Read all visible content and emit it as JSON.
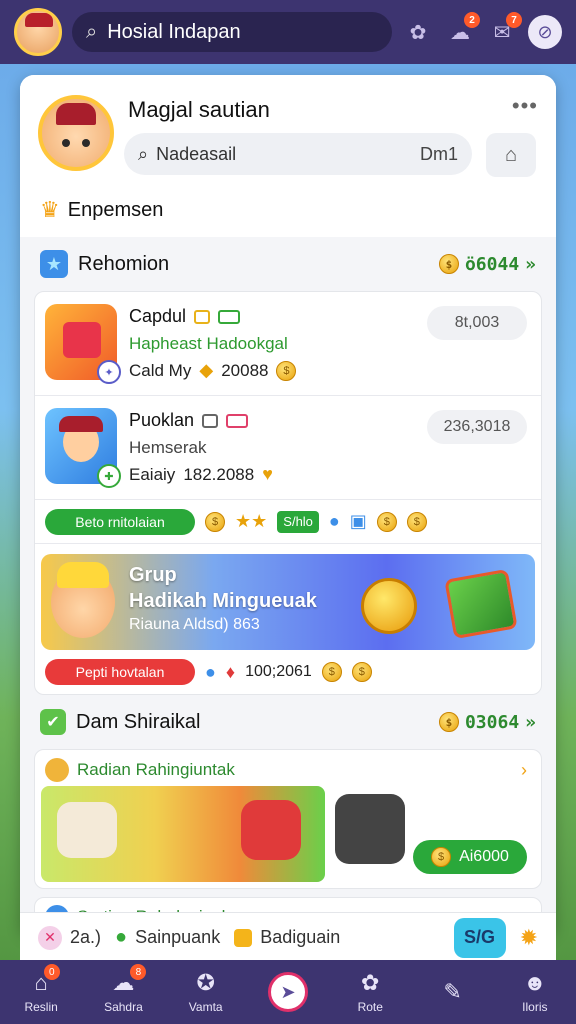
{
  "topbar": {
    "search_text": "Hosial Indapan",
    "badge_1": "2",
    "badge_2": "7"
  },
  "profile": {
    "name": "Magjal sautian",
    "search_value": "Nadeasail",
    "search_suffix": "Dm1",
    "subtitle": "Enpemsen"
  },
  "section1": {
    "title": "Rehomion",
    "value": "ö6044"
  },
  "rows": [
    {
      "title": "Capdul",
      "subtitle": "Hapheast Hadookgal",
      "meta_label": "Cald My",
      "meta_value": "20088",
      "pill": "8t,003"
    },
    {
      "title": "Puoklan",
      "subtitle": "Hemserak",
      "meta_label": "Eaiaiy",
      "meta_value": "182.2088",
      "pill": "236,3018"
    }
  ],
  "actionbar1": {
    "button": "Beto rnitolaian",
    "chip": "S/hlo"
  },
  "promo": {
    "title": "Grup",
    "subtitle": "Hadikah Mingueuak",
    "detail": "Riauna Aldsd) 863",
    "button": "Pepti hovtalan",
    "value": "100;2061"
  },
  "section2": {
    "title": "Dam Shiraikal",
    "value": "03064"
  },
  "games": {
    "title": "Radian Rahingiuntak",
    "pill": "Ai6000"
  },
  "next_row": {
    "title": "Sartian Raholngiaak"
  },
  "quickbar": {
    "item1": "2a.)",
    "item2": "Sainpuank",
    "item3": "Badiguain",
    "button": "S/G"
  },
  "bottomnav": [
    {
      "label": "Reslin",
      "badge": "0"
    },
    {
      "label": "Sahdra",
      "badge": "8"
    },
    {
      "label": "Vamta",
      "badge": ""
    },
    {
      "label": "",
      "badge": ""
    },
    {
      "label": "Rote",
      "badge": ""
    },
    {
      "label": "",
      "badge": ""
    },
    {
      "label": "Iloris",
      "badge": ""
    }
  ]
}
